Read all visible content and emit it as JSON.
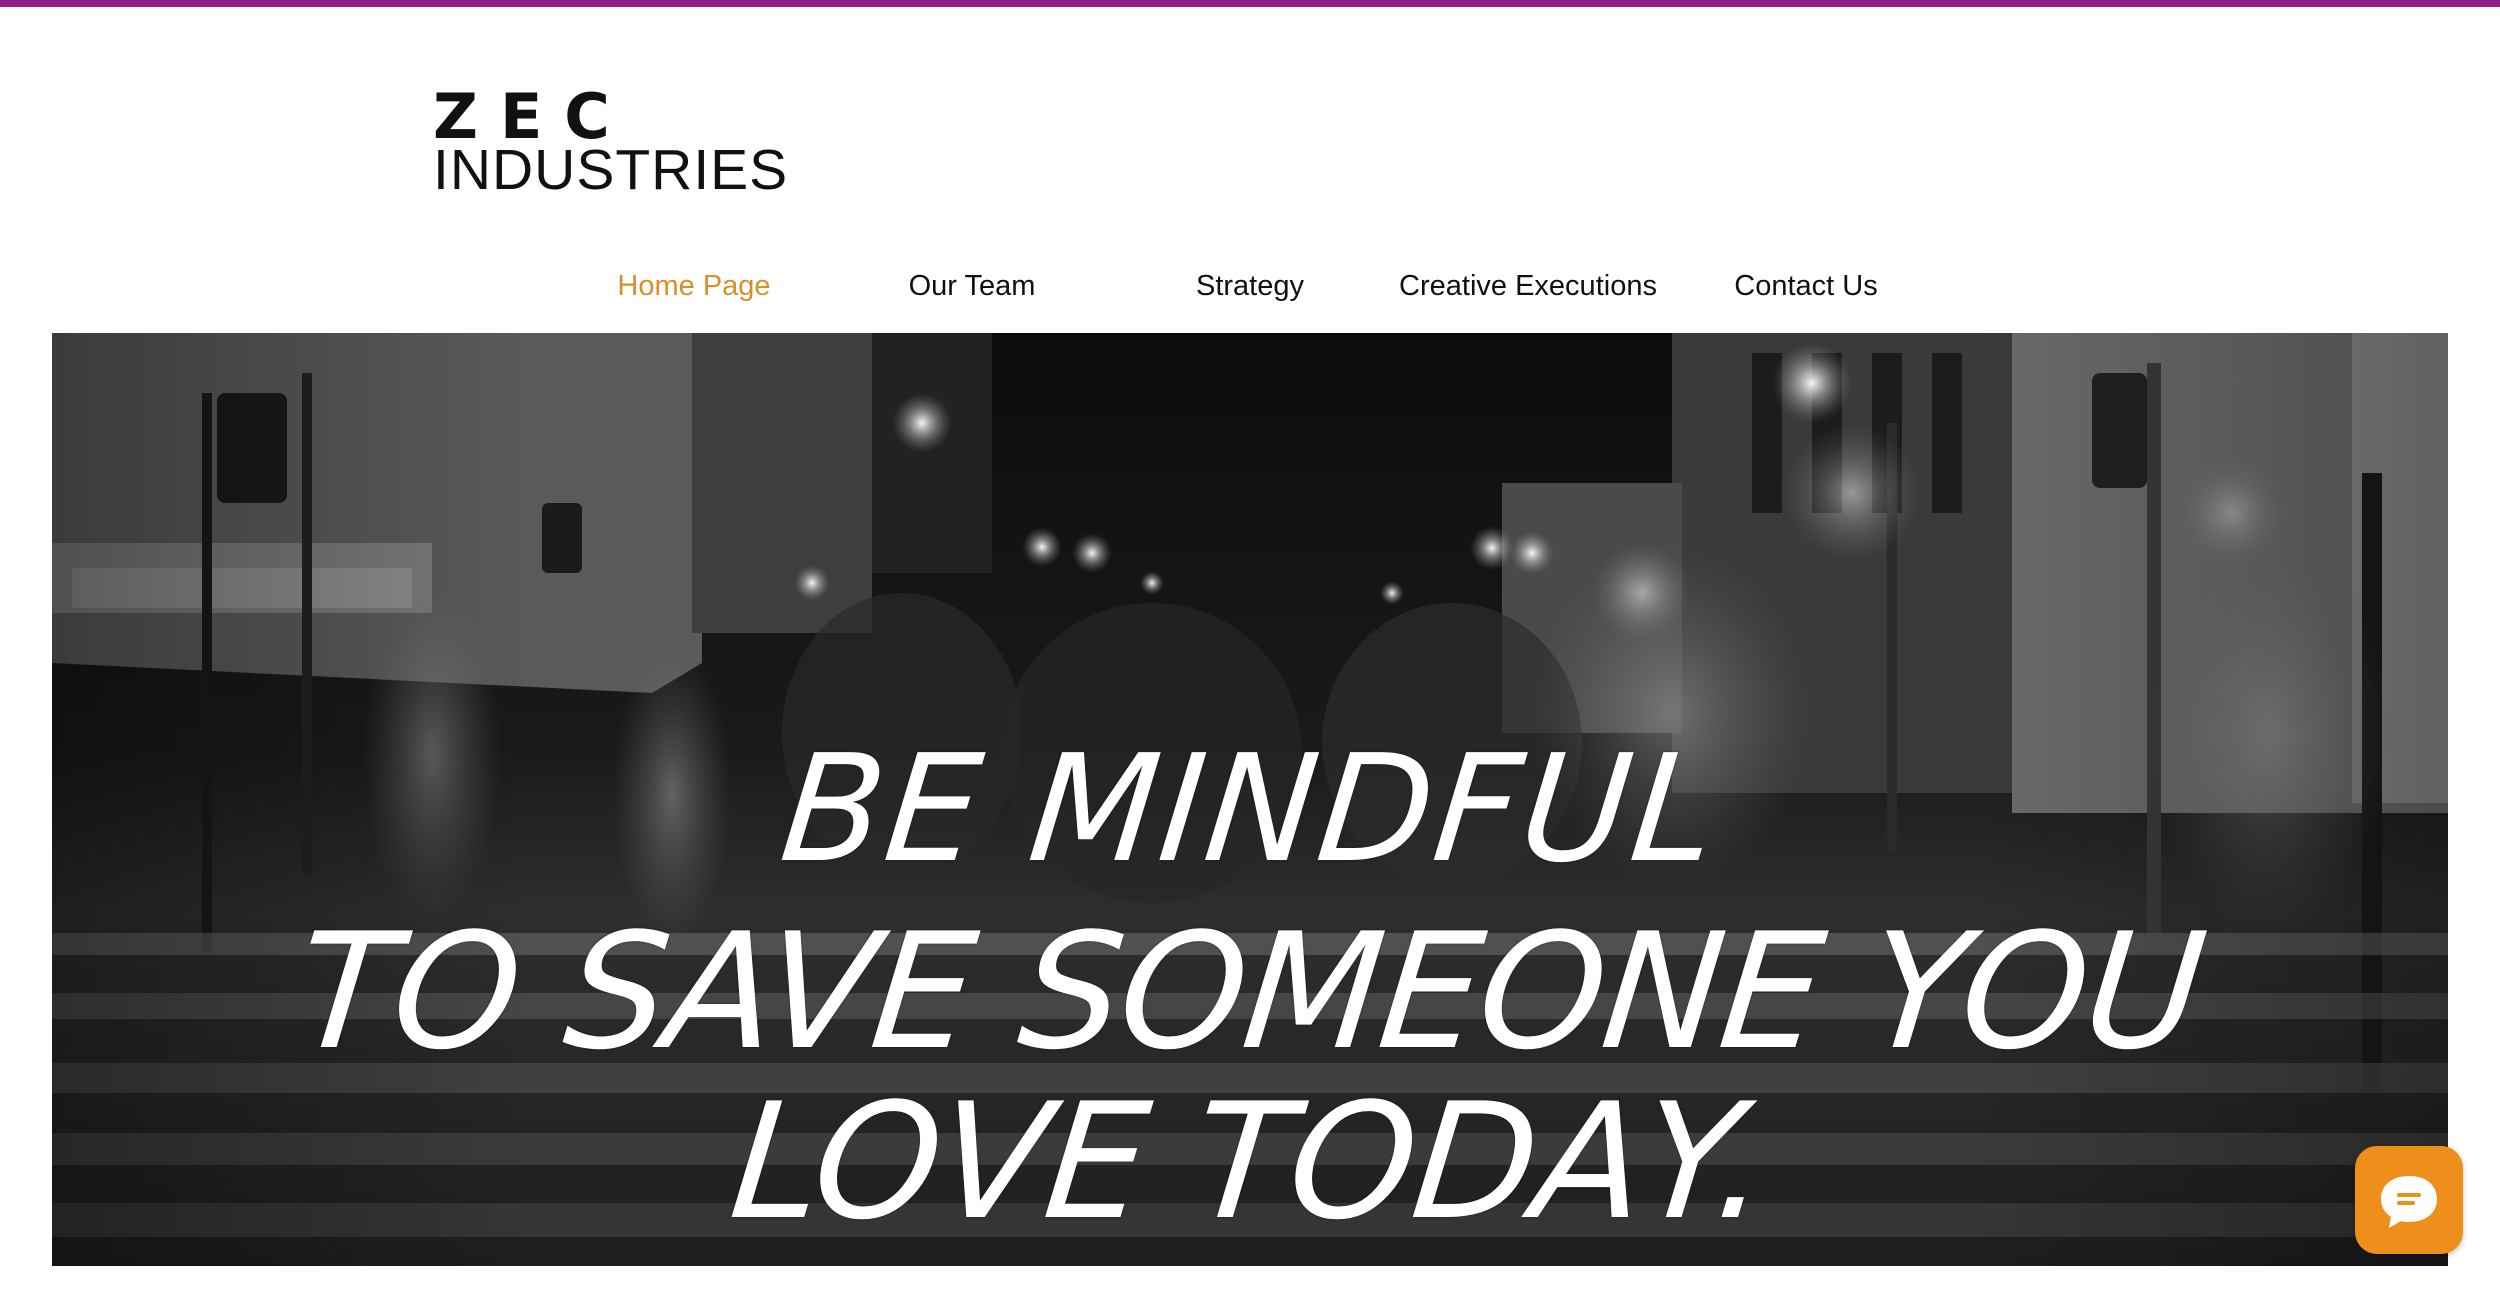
{
  "brand": {
    "line1": "ZEC",
    "line2": "INDUSTRIES"
  },
  "nav": {
    "items": [
      {
        "label": "Home Page",
        "active": true
      },
      {
        "label": "Our Team",
        "active": false
      },
      {
        "label": "Strategy",
        "active": false
      },
      {
        "label": "Creative Executions",
        "active": false
      },
      {
        "label": "Contact Us",
        "active": false
      }
    ]
  },
  "hero": {
    "line1": "BE MINDFUL",
    "line2": "TO SAVE SOMEONE YOU",
    "line3": "LOVE TODAY."
  },
  "colors": {
    "top_bar": "#8e1f8a",
    "nav_active": "#d98f2b",
    "chat_button": "#ee8f1b"
  },
  "chat": {
    "icon": "chat-bubble-icon"
  }
}
